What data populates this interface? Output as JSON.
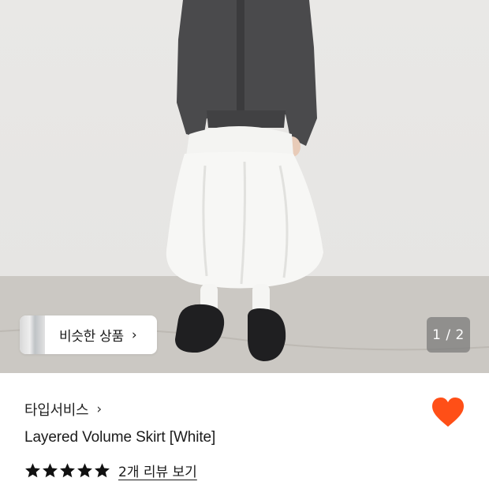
{
  "carousel": {
    "similar_button_label": "비슷한 상품",
    "similar_chevron": "›",
    "page_indicator": "1 / 2"
  },
  "product": {
    "brand": "타입서비스",
    "brand_chevron": "›",
    "title": "Layered Volume Skirt [White]",
    "rating_stars": 5,
    "review_link": "2개 리뷰 보기",
    "wishlisted": true
  },
  "colors": {
    "heart": "#ff4f17",
    "star": "#111111",
    "indicator_bg": "#7a7a7a"
  },
  "icons": {
    "heart": "heart-icon",
    "star": "star-icon",
    "chevron": "chevron-right-icon"
  }
}
